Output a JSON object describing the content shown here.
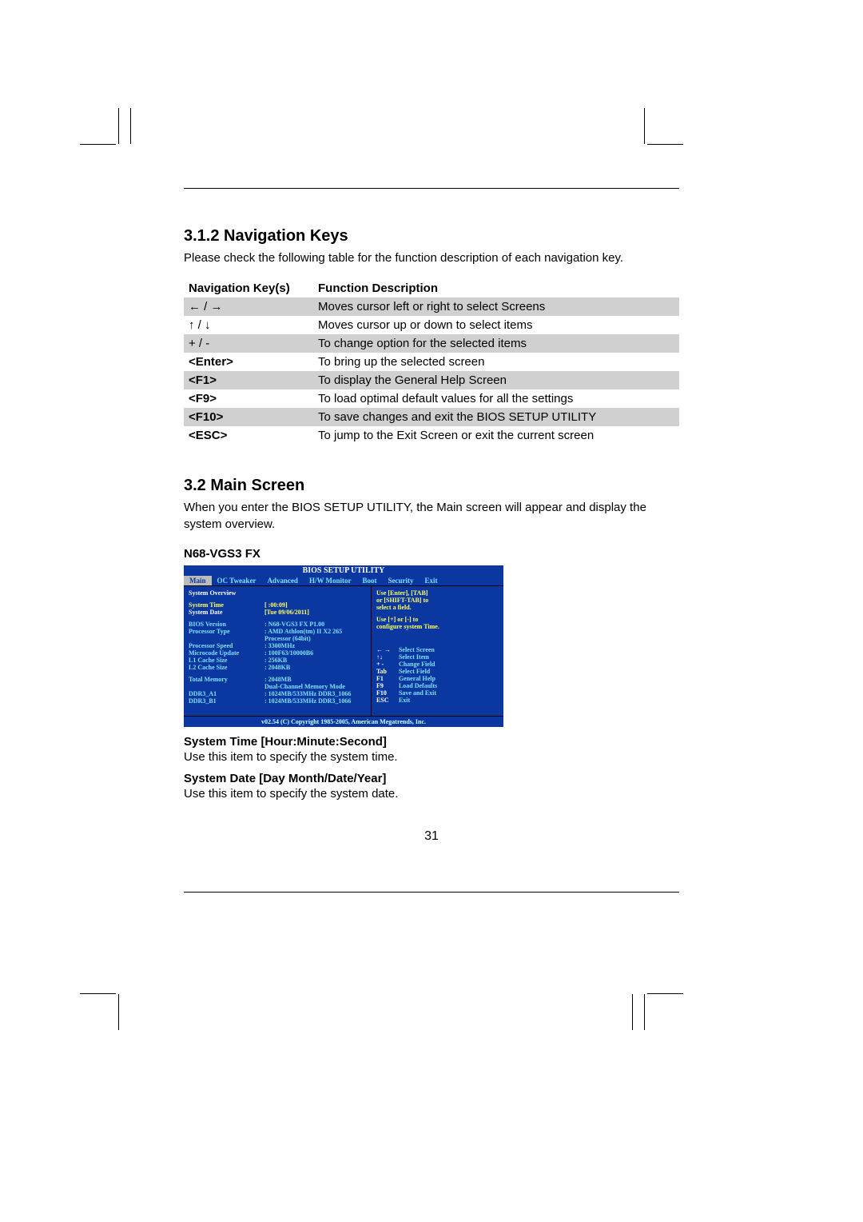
{
  "section1": {
    "heading": "3.1.2 Navigation Keys",
    "intro": "Please check the following table for the function description of each navigation key."
  },
  "navtable": {
    "col1": "Navigation Key(s)",
    "col2": "Function Description",
    "rows": [
      {
        "key": "← / →",
        "desc": "Moves cursor left or right to select Screens",
        "bold": false
      },
      {
        "key": "↑ / ↓",
        "desc": "Moves cursor up or down to select items",
        "bold": false
      },
      {
        "key": "+  /  -",
        "desc": "To change option for the selected items",
        "bold": false
      },
      {
        "key": "<Enter>",
        "desc": "To bring up the selected screen",
        "bold": true
      },
      {
        "key": "<F1>",
        "desc": "To display the General Help Screen",
        "bold": true
      },
      {
        "key": "<F9>",
        "desc": "To load optimal default values for all the settings",
        "bold": true
      },
      {
        "key": "<F10>",
        "desc": "To save changes and exit the BIOS SETUP UTILITY",
        "bold": true
      },
      {
        "key": "<ESC>",
        "desc": "To jump to the Exit Screen or exit the current screen",
        "bold": true
      }
    ]
  },
  "section2": {
    "heading": "3.2   Main Screen",
    "intro": "When you enter the BIOS SETUP UTILITY, the Main screen will appear and display the system overview.",
    "model": "N68-VGS3 FX"
  },
  "bios": {
    "title": "BIOS SETUP UTILITY",
    "menu": [
      "Main",
      "OC Tweaker",
      "Advanced",
      "H/W Monitor",
      "Boot",
      "Security",
      "Exit"
    ],
    "overview": "System Overview",
    "systime_label": "System Time",
    "systime_value": "[   :00:09]",
    "sysdate_label": "System Date",
    "sysdate_value": "[Tue 09/06/2011]",
    "info": [
      {
        "lbl": "BIOS Version",
        "val": ": N68-VGS3 FX P1.00"
      },
      {
        "lbl": "Processor Type",
        "val": ": AMD Athlon(tm) II X2 265"
      },
      {
        "lbl": "",
        "val": "  Processor (64bit)"
      },
      {
        "lbl": "Processor Speed",
        "val": ": 3300MHz"
      },
      {
        "lbl": "Microcode Update",
        "val": ": 100F63/10000B6"
      },
      {
        "lbl": "L1 Cache Size",
        "val": ": 256KB"
      },
      {
        "lbl": "L2 Cache Size",
        "val": ": 2048KB"
      }
    ],
    "mem": [
      {
        "lbl": "Total Memory",
        "val": ": 2048MB"
      },
      {
        "lbl": "",
        "val": "  Dual-Channel Memory Mode"
      },
      {
        "lbl": "  DDR3_A1",
        "val": ": 1024MB/533MHz DDR3_1066"
      },
      {
        "lbl": "  DDR3_B1",
        "val": ": 1024MB/533MHz DDR3_1066"
      }
    ],
    "hint1": "Use [Enter], [TAB]",
    "hint2": "or [SHIFT-TAB] to",
    "hint3": "select a field.",
    "hint4": "Use [+] or [-] to",
    "hint5": "configure system Time.",
    "legend": [
      {
        "k": "← →",
        "d": "Select Screen"
      },
      {
        "k": "↑↓",
        "d": "Select Item"
      },
      {
        "k": "+ -",
        "d": "Change Field"
      },
      {
        "k": "Tab",
        "d": "Select Field"
      },
      {
        "k": "F1",
        "d": "General Help"
      },
      {
        "k": "F9",
        "d": "Load Defaults"
      },
      {
        "k": "F10",
        "d": "Save and Exit"
      },
      {
        "k": "ESC",
        "d": "Exit"
      }
    ],
    "footer": "v02.54 (C) Copyright 1985-2005, American Megatrends, Inc."
  },
  "items": {
    "h1": "System Time [Hour:Minute:Second]",
    "t1": "Use this item to specify the system time.",
    "h2": "System Date [Day Month/Date/Year]",
    "t2": "Use this item to specify the system date."
  },
  "pagenum": "31"
}
